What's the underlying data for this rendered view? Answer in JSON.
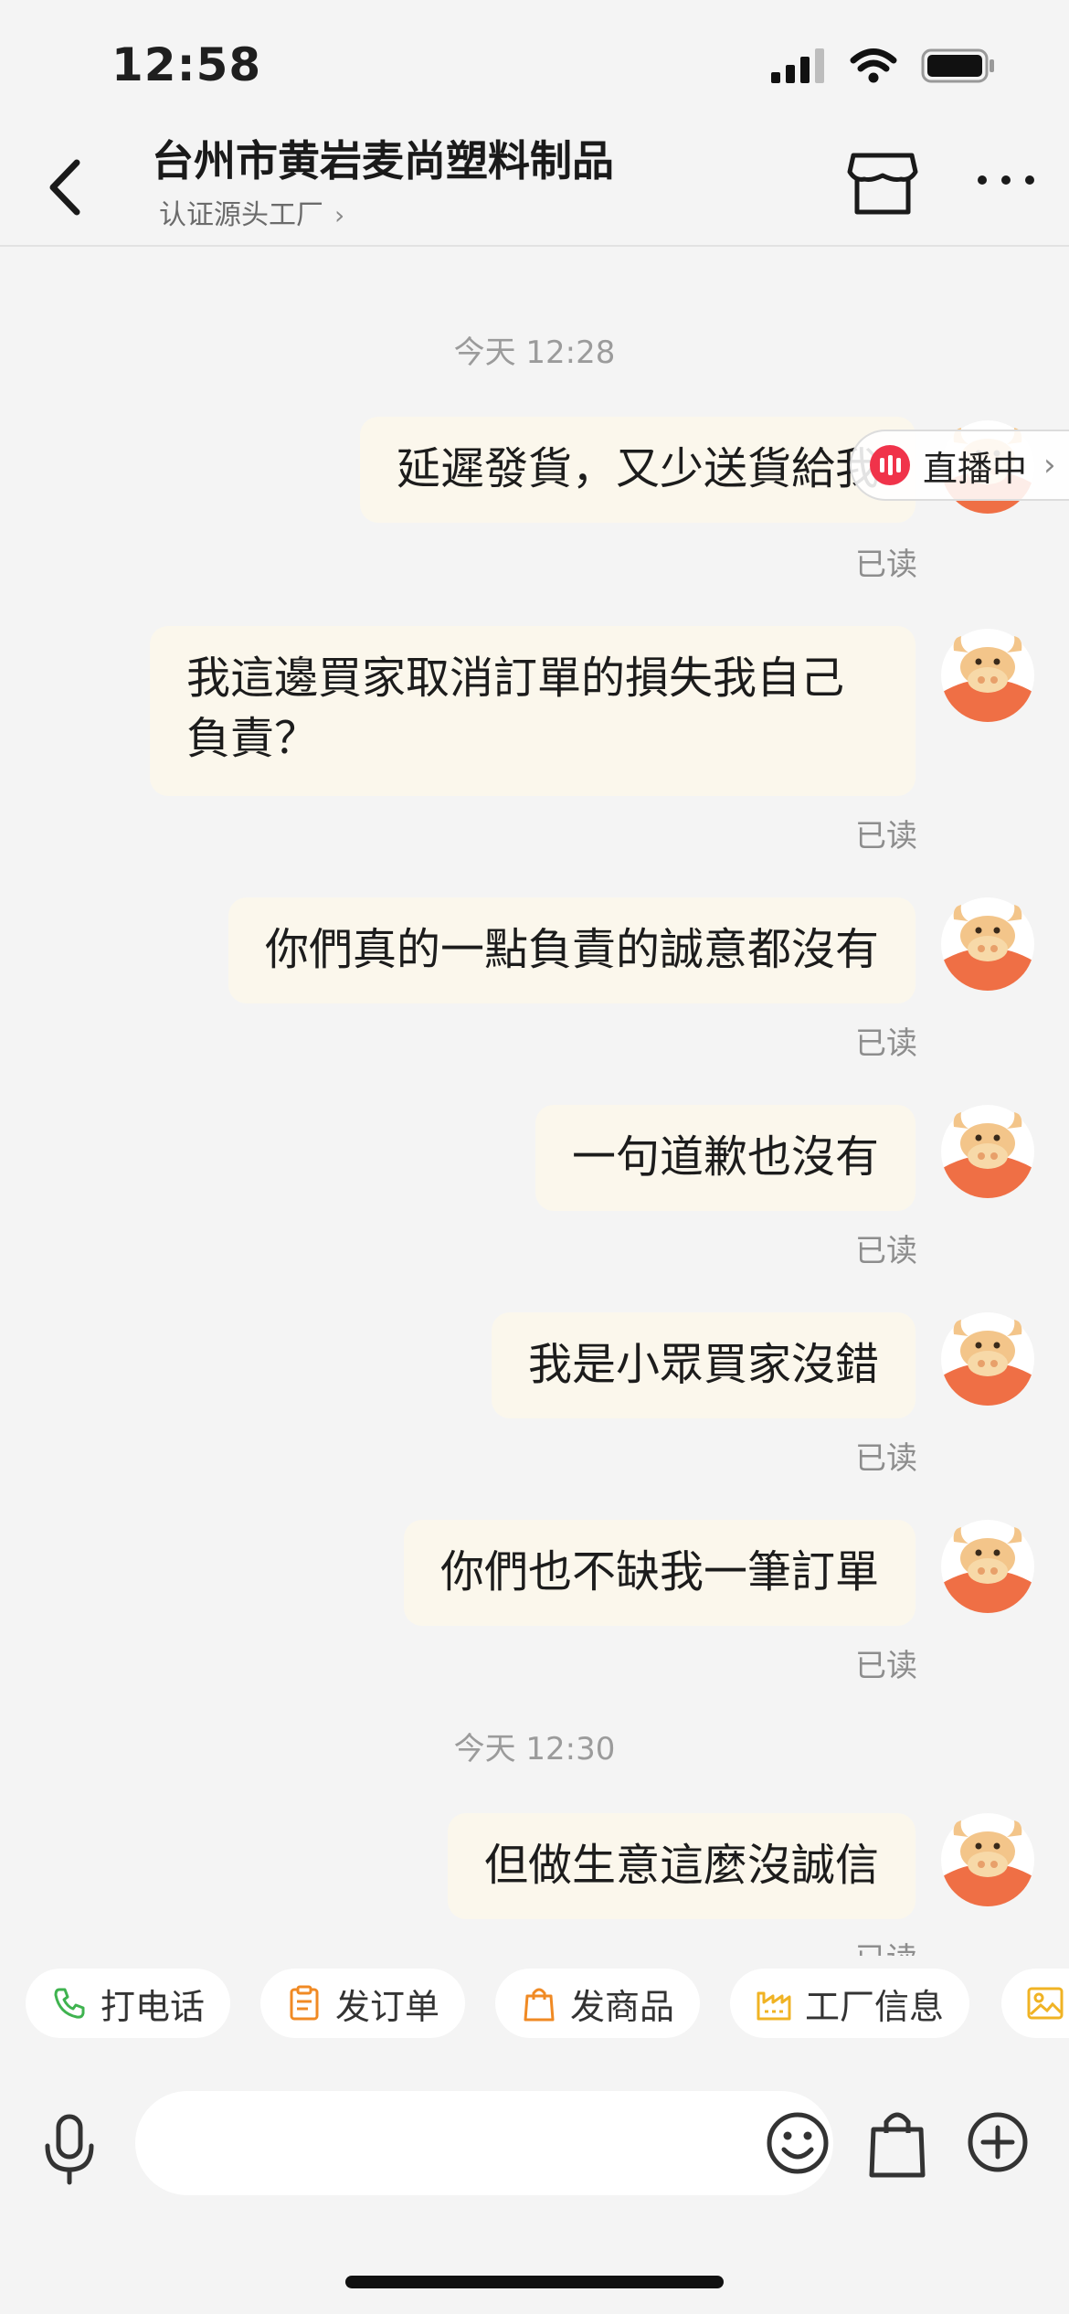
{
  "status_bar": {
    "time": "12:58"
  },
  "header": {
    "title": "台州市黄岩麦尚塑料制品",
    "subtitle": "认证源头工厂",
    "subtitle_chevron": "›"
  },
  "live_badge": {
    "label": "直播中",
    "chevron": "›"
  },
  "messages": [
    {
      "type": "timestamp",
      "text": "今天 12:28"
    },
    {
      "type": "outgoing",
      "text": "延遲發貨，又少送貨給我",
      "read": "已读"
    },
    {
      "type": "outgoing",
      "text": "我這邊買家取消訂單的損失我自己負責？",
      "read": "已读"
    },
    {
      "type": "outgoing",
      "text": "你們真的一點負責的誠意都沒有",
      "read": "已读"
    },
    {
      "type": "outgoing",
      "text": "一句道歉也沒有",
      "read": "已读"
    },
    {
      "type": "outgoing",
      "text": "我是小眾買家沒錯",
      "read": "已读"
    },
    {
      "type": "outgoing",
      "text": "你們也不缺我一筆訂單",
      "read": "已读"
    },
    {
      "type": "timestamp",
      "text": "今天 12:30"
    },
    {
      "type": "outgoing",
      "text": "但做生意這麼沒誠信",
      "read": "已读"
    }
  ],
  "quick_actions": [
    {
      "label": "打电话",
      "icon": "phone-icon",
      "color": "#3fb34f"
    },
    {
      "label": "发订单",
      "icon": "clipboard-icon",
      "color": "#f08a24"
    },
    {
      "label": "发商品",
      "icon": "shopping-bag-icon",
      "color": "#f08a24"
    },
    {
      "label": "工厂信息",
      "icon": "factory-icon",
      "color": "#f0b324"
    },
    {
      "label": "",
      "icon": "image-icon",
      "color": "#f0b324"
    }
  ],
  "input": {
    "placeholder": ""
  },
  "colors": {
    "bubble": "#fbf7ec",
    "background": "#f4f4f4",
    "avatar": "#ef6f45",
    "live": "#f0334a"
  }
}
